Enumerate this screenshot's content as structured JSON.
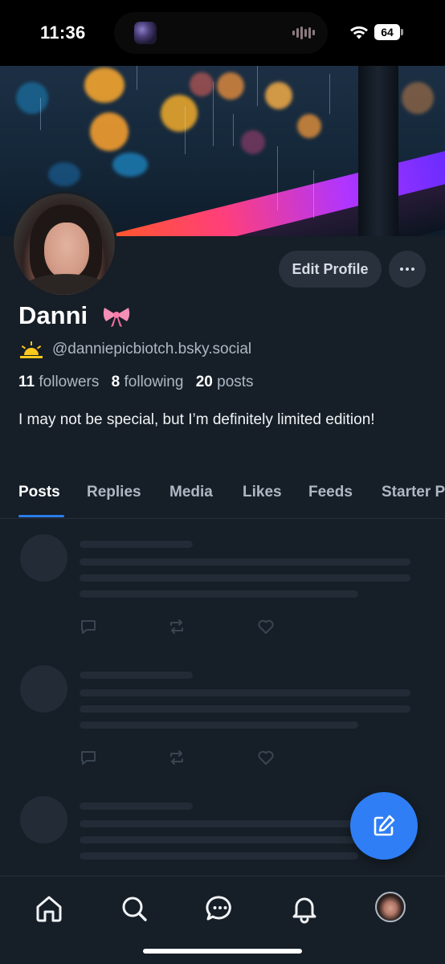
{
  "status_bar": {
    "time": "11:36",
    "battery": "64",
    "wifi_icon": "wifi-icon"
  },
  "profile": {
    "display_name": "Danni",
    "name_emoji_icon": "ribbon-bow-icon",
    "handle_prefix_icon": "sunrise-icon",
    "handle": "@danniepicbiotch.bsky.social",
    "followers_count": "11",
    "followers_label": "followers",
    "following_count": "8",
    "following_label": "following",
    "posts_count": "20",
    "posts_label": "posts",
    "bio": "I may not be special, but I’m definitely limited edition!"
  },
  "actions": {
    "edit_profile_label": "Edit Profile",
    "more_icon": "ellipsis-icon"
  },
  "tabs": [
    {
      "label": "Posts",
      "active": true
    },
    {
      "label": "Replies",
      "active": false
    },
    {
      "label": "Media",
      "active": false
    },
    {
      "label": "Likes",
      "active": false
    },
    {
      "label": "Feeds",
      "active": false
    },
    {
      "label": "Starter Packs",
      "active": false
    }
  ],
  "feed": {
    "state": "loading",
    "skeleton_count": 3
  },
  "fab": {
    "icon": "compose-icon"
  },
  "bottom_nav": [
    {
      "icon": "home-icon"
    },
    {
      "icon": "search-icon"
    },
    {
      "icon": "chat-icon"
    },
    {
      "icon": "notifications-bell-icon"
    },
    {
      "icon": "profile-avatar"
    }
  ],
  "colors": {
    "background": "#161e27",
    "accent": "#2f7ef6",
    "tab_indicator": "#2b7de9",
    "muted_text": "#aeb8c3",
    "skeleton": "#222b36"
  }
}
